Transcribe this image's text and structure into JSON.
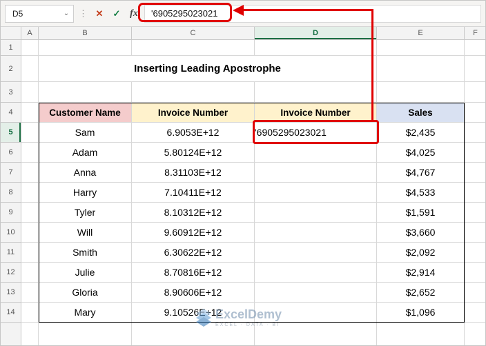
{
  "formula_bar": {
    "name_box_value": "D5",
    "formula_text": "'6905295023021"
  },
  "icons": {
    "dropdown": "⌄",
    "divider": "⋮",
    "cancel": "✕",
    "enter": "✓",
    "fx": "fx"
  },
  "column_headers": [
    "A",
    "B",
    "C",
    "D",
    "E",
    "F"
  ],
  "row_headers": [
    "1",
    "2",
    "3",
    "4",
    "5",
    "6",
    "7",
    "8",
    "9",
    "10",
    "11",
    "12",
    "13",
    "14"
  ],
  "sheet": {
    "title": "Inserting Leading Apostrophe",
    "selected_cell": "D5"
  },
  "invoice_table": {
    "headers": {
      "customer": "Customer Name",
      "invoice_sci": "Invoice Number",
      "invoice_text": "Invoice Number",
      "sales": "Sales"
    },
    "rows": [
      {
        "customer": "Sam",
        "invoice_sci": "6.9053E+12",
        "invoice_text": "'6905295023021",
        "sales": "$2,435"
      },
      {
        "customer": "Adam",
        "invoice_sci": "5.80124E+12",
        "invoice_text": "",
        "sales": "$4,025"
      },
      {
        "customer": "Anna",
        "invoice_sci": "8.31103E+12",
        "invoice_text": "",
        "sales": "$4,767"
      },
      {
        "customer": "Harry",
        "invoice_sci": "7.10411E+12",
        "invoice_text": "",
        "sales": "$4,533"
      },
      {
        "customer": "Tyler",
        "invoice_sci": "8.10312E+12",
        "invoice_text": "",
        "sales": "$1,591"
      },
      {
        "customer": "Will",
        "invoice_sci": "9.60912E+12",
        "invoice_text": "",
        "sales": "$3,660"
      },
      {
        "customer": "Smith",
        "invoice_sci": "6.30622E+12",
        "invoice_text": "",
        "sales": "$2,092"
      },
      {
        "customer": "Julie",
        "invoice_sci": "8.70816E+12",
        "invoice_text": "",
        "sales": "$2,914"
      },
      {
        "customer": "Gloria",
        "invoice_sci": "8.90606E+12",
        "invoice_text": "",
        "sales": "$2,652"
      },
      {
        "customer": "Mary",
        "invoice_sci": "9.10526E+12",
        "invoice_text": "",
        "sales": "$1,096"
      }
    ]
  },
  "watermark": {
    "name": "ExcelDemy",
    "tagline": "EXCEL · DATA · BI"
  },
  "colors": {
    "customer_header_fill": "#f4cccc",
    "invoice_header_fill": "#fff2cc",
    "sales_header_fill": "#d9e1f2",
    "annotation_red": "#e00000",
    "selection_green": "#1e7145",
    "watermark_blue": "#6f8cab"
  }
}
